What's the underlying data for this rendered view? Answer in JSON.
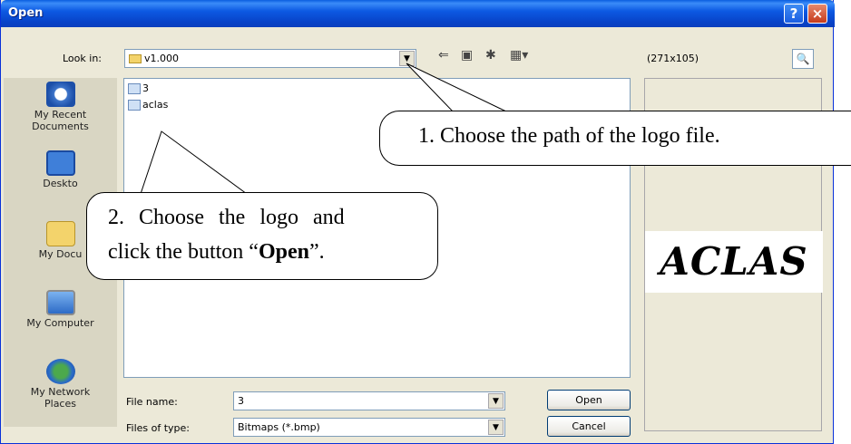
{
  "window": {
    "title": "Open",
    "help_label": "?",
    "close_label": "×"
  },
  "lookin": {
    "label": "Look in:",
    "value": "v1.000"
  },
  "preview": {
    "size": "(271x105)",
    "logo_text": "ACLAS"
  },
  "places": [
    {
      "label": "My Recent\nDocuments"
    },
    {
      "label": "Deskto"
    },
    {
      "label": "My Docu"
    },
    {
      "label": "My Computer"
    },
    {
      "label": "My Network\nPlaces"
    }
  ],
  "files": [
    {
      "name": "3"
    },
    {
      "name": "aclas"
    }
  ],
  "filename": {
    "label": "File name:",
    "value": "3"
  },
  "filetype": {
    "label": "Files of type:",
    "value": "Bitmaps (*.bmp)"
  },
  "buttons": {
    "open": "Open",
    "cancel": "Cancel"
  },
  "callouts": {
    "one": "1. Choose the path of the logo file.",
    "two_line1": "2. Choose the logo and",
    "two_line2_prefix": "click the button “",
    "two_line2_bold": "Open",
    "two_line2_suffix": "”."
  },
  "colors": {
    "titlebar": "#0a4fd4",
    "dialog": "#ece9d8",
    "close": "#c63b1c"
  }
}
